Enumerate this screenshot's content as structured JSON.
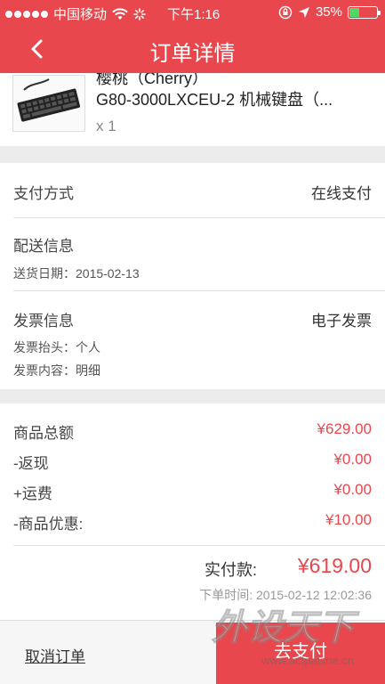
{
  "status_bar": {
    "carrier": "中国移动",
    "time": "下午1:16",
    "battery": "35%",
    "battery_level": 0.35,
    "icons": [
      "signal-dots-icon",
      "wifi-icon",
      "loading-icon",
      "orientation-lock-icon",
      "location-arrow-icon",
      "battery-icon"
    ]
  },
  "nav": {
    "title": "订单详情",
    "back_icon": "chevron-left-icon"
  },
  "product": {
    "name_top": "樱桃（Cherry）",
    "name": "G80-3000LXCEU-2 机械键盘（...",
    "quantity": "x 1",
    "image_icon": "keyboard-image"
  },
  "info": {
    "payment_label": "支付方式",
    "payment_value": "在线支付",
    "delivery_label": "配送信息",
    "delivery_date": "送货日期：2015-02-13",
    "invoice_label": "发票信息",
    "invoice_value": "电子发票",
    "invoice_title": "发票抬头：个人",
    "invoice_content": "发票内容：明细"
  },
  "totals": {
    "items": [
      {
        "label": "商品总额",
        "value": "¥629.00"
      },
      {
        "label": "-返现",
        "value": "¥0.00"
      },
      {
        "label": "+运费",
        "value": "¥0.00"
      },
      {
        "label": "-商品优惠:",
        "value": "¥10.00"
      }
    ],
    "paid_label": "实付款:",
    "paid_value": "¥619.00",
    "order_time": "下单时间:   2015-02-12 12:02:36"
  },
  "footer": {
    "cancel_label": "取消订单",
    "pay_label": "去支付"
  },
  "watermark": {
    "text": "外设天下",
    "sub": "www.acfpaisne.cn"
  },
  "colors": {
    "brand_red": "#e8484d",
    "battery_green": "#4cd964"
  }
}
